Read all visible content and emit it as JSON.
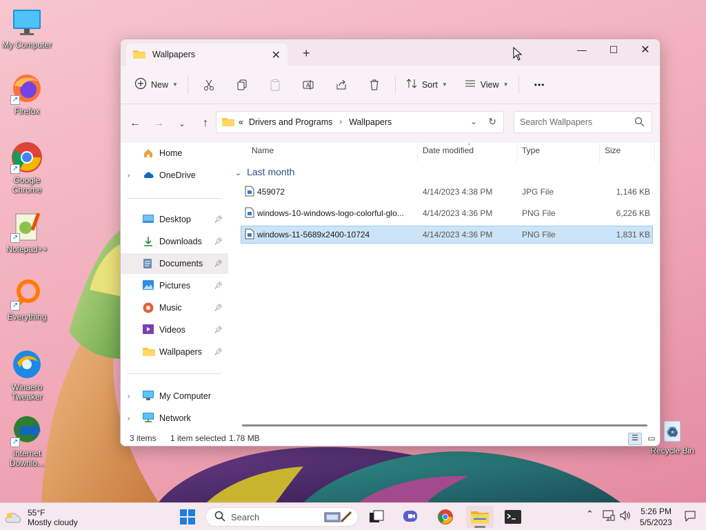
{
  "desktop": {
    "icons": [
      {
        "label": "My Computer",
        "icon": "monitor-icon"
      },
      {
        "label": "Firefox",
        "icon": "firefox-icon"
      },
      {
        "label": "Google Chrome",
        "icon": "chrome-icon"
      },
      {
        "label": "Notepad++",
        "icon": "notepadpp-icon"
      },
      {
        "label": "Everything",
        "icon": "everything-icon"
      },
      {
        "label": "Winaero Tweaker",
        "icon": "winaero-icon"
      },
      {
        "label": "Internet Downlo...",
        "icon": "idm-icon"
      },
      {
        "label": "Recycle Bin",
        "icon": "recycle-bin-icon"
      }
    ]
  },
  "window": {
    "tab_title": "Wallpapers",
    "toolbar": {
      "new_label": "New",
      "sort_label": "Sort",
      "view_label": "View",
      "more_label": "•••"
    },
    "address": {
      "prefix": "«",
      "crumbs": [
        "Drivers and Programs",
        "Wallpapers"
      ]
    },
    "search_placeholder": "Search Wallpapers",
    "sidebar": {
      "items": [
        {
          "label": "Home",
          "icon": "home-icon"
        },
        {
          "label": "OneDrive",
          "icon": "onedrive-icon"
        },
        {
          "label": "Desktop",
          "icon": "desktop-folder-icon"
        },
        {
          "label": "Downloads",
          "icon": "downloads-icon"
        },
        {
          "label": "Documents",
          "icon": "documents-icon"
        },
        {
          "label": "Pictures",
          "icon": "pictures-icon"
        },
        {
          "label": "Music",
          "icon": "music-icon"
        },
        {
          "label": "Videos",
          "icon": "videos-icon"
        },
        {
          "label": "Wallpapers",
          "icon": "folder-icon"
        },
        {
          "label": "My Computer",
          "icon": "monitor-icon"
        },
        {
          "label": "Network",
          "icon": "network-icon"
        }
      ]
    },
    "columns": [
      "Name",
      "Date modified",
      "Type",
      "Size"
    ],
    "group_label": "Last month",
    "files": [
      {
        "name": "459072",
        "date": "4/14/2023 4:38 PM",
        "type": "JPG File",
        "size": "1,146 KB"
      },
      {
        "name": "windows-10-windows-logo-colorful-glo...",
        "date": "4/14/2023 4:36 PM",
        "type": "PNG File",
        "size": "6,226 KB"
      },
      {
        "name": "windows-11-5689x2400-10724",
        "date": "4/14/2023 4:36 PM",
        "type": "PNG File",
        "size": "1,831 KB"
      }
    ],
    "status": {
      "items": "3 items",
      "selected": "1 item selected",
      "size": "1.78 MB"
    }
  },
  "taskbar": {
    "weather_temp": "55°F",
    "weather_desc": "Mostly cloudy",
    "search_label": "Search",
    "time": "5:26 PM",
    "date": "5/5/2023"
  }
}
